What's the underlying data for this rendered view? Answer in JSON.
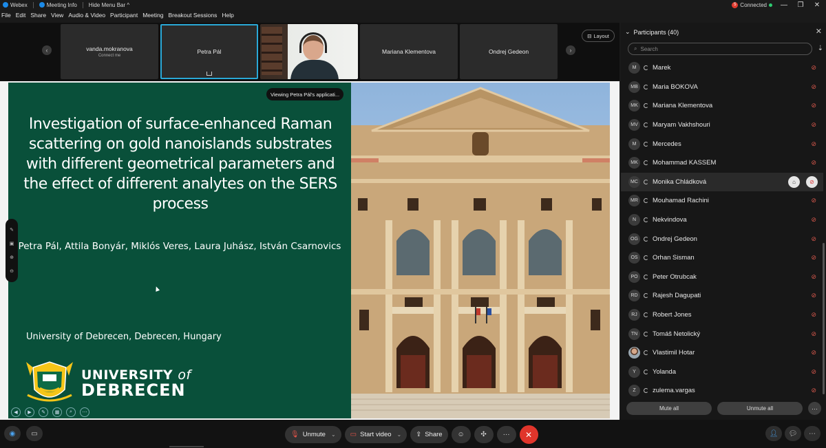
{
  "titlebar": {
    "app_name": "Webex",
    "meeting_info": "Meeting Info",
    "hide_menu": "Hide Menu Bar ^",
    "connection": "Connected",
    "connection_count": "5",
    "minimize": "—",
    "restore": "❐",
    "close": "✕"
  },
  "menu": [
    "File",
    "Edit",
    "Share",
    "View",
    "Audio & Video",
    "Participant",
    "Meeting",
    "Breakout Sessions",
    "Help"
  ],
  "strip": {
    "prev": "‹",
    "next": "›",
    "tiles": [
      {
        "name": "vanda.mokranova",
        "sub": "Connect me"
      },
      {
        "name": "Petra Pál"
      },
      {
        "name": "Mariana Klementova"
      },
      {
        "name": "Ondrej Gedeon"
      }
    ],
    "layout_label": "Layout"
  },
  "slide": {
    "viewing": "Viewing Petra Pál's applicati...",
    "title": "Investigation of surface-enhanced Raman scattering on gold nanoislands substrates with different geometrical parameters and the effect of different analytes on the SERS process",
    "authors": "Petra Pál, Attila Bonyár, Miklós Veres, Laura Juhász, István Csarnovics",
    "university_line": "University of Debrecen, Debrecen, Hungary",
    "logo_line1": "UNIVERSITY",
    "logo_of": "of",
    "logo_line2": "DEBRECEN"
  },
  "panel": {
    "title": "Participants (40)",
    "search_placeholder": "Search",
    "participants": [
      {
        "initials": "M",
        "name": "Marek"
      },
      {
        "initials": "MB",
        "name": "Maria BOKOVA"
      },
      {
        "initials": "MK",
        "name": "Mariana Klementova"
      },
      {
        "initials": "MV",
        "name": "Maryam Vakhshouri"
      },
      {
        "initials": "M",
        "name": "Mercedes"
      },
      {
        "initials": "MK",
        "name": "Mohammad KASSEM"
      },
      {
        "initials": "MC",
        "name": "Monika Chládková"
      },
      {
        "initials": "MR",
        "name": "Mouhamad Rachini"
      },
      {
        "initials": "N",
        "name": "Nekvindova"
      },
      {
        "initials": "OG",
        "name": "Ondrej Gedeon"
      },
      {
        "initials": "OS",
        "name": "Orhan Sisman"
      },
      {
        "initials": "PO",
        "name": "Peter Otrubcak"
      },
      {
        "initials": "RD",
        "name": "Rajesh Dagupati"
      },
      {
        "initials": "RJ",
        "name": "Robert Jones"
      },
      {
        "initials": "TN",
        "name": "Tomáš Netolický"
      },
      {
        "initials": "",
        "name": "Vlastimil Hotar"
      },
      {
        "initials": "Y",
        "name": "Yolanda"
      },
      {
        "initials": "Z",
        "name": "zulema.vargas"
      }
    ],
    "mute_all": "Mute all",
    "unmute_all": "Unmute all",
    "more": "···"
  },
  "controls": {
    "unmute": "Unmute",
    "start_video": "Start video",
    "share": "Share",
    "more": "···",
    "end": "✕"
  },
  "colors": {
    "slide_green": "#09503a",
    "accent_blue": "#2aa9d8",
    "mute_red": "#e05a4e",
    "end_red": "#e0352b"
  }
}
